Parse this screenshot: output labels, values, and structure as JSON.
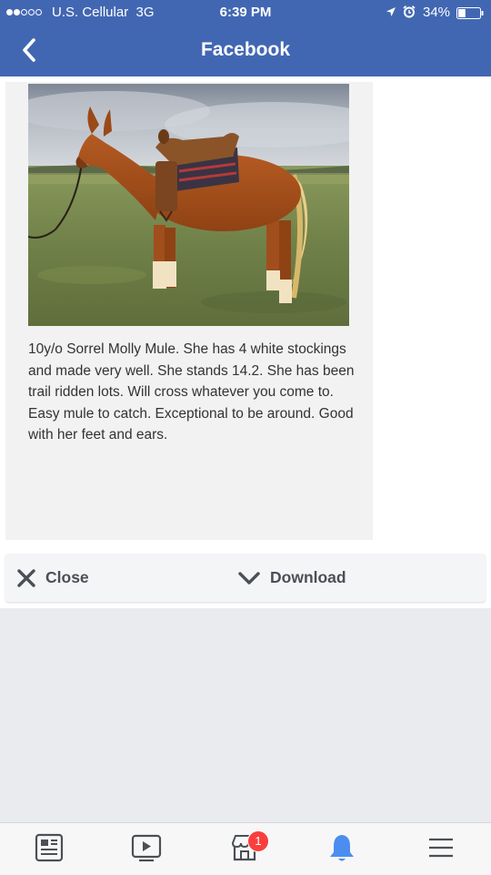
{
  "status_bar": {
    "signal_dots": 5,
    "signal_filled": 2,
    "carrier": "U.S. Cellular",
    "network": "3G",
    "time": "6:39 PM",
    "battery_percent": "34%",
    "battery_level": 0.34,
    "icons": [
      "location-arrow-icon",
      "alarm-clock-icon",
      "battery-icon"
    ]
  },
  "header": {
    "back_icon": "chevron-left-icon",
    "title": "Facebook"
  },
  "post": {
    "photo": "horse-photo",
    "text": "10y/o Sorrel Molly Mule. She has 4 white stockings  and made very well. She stands 14.2. She has been trail ridden lots. Will cross whatever you come to. Easy mule to catch. Exceptional to be around. Good with her feet and ears."
  },
  "actions": {
    "close_label": "Close",
    "close_icon": "x-icon",
    "download_label": "Download",
    "download_icon": "chevron-down-icon"
  },
  "tab_bar": {
    "tabs": [
      {
        "name": "news-feed",
        "icon": "news-feed-icon",
        "active": false
      },
      {
        "name": "watch",
        "icon": "video-play-icon",
        "active": false
      },
      {
        "name": "marketplace",
        "icon": "marketplace-shop-icon",
        "active": false,
        "badge": "1"
      },
      {
        "name": "notifications",
        "icon": "bell-icon",
        "active": true
      },
      {
        "name": "menu",
        "icon": "hamburger-menu-icon",
        "active": false
      }
    ]
  },
  "colors": {
    "brand_blue": "#4267b2",
    "active_tab": "#4b8ef0",
    "badge_red": "#fa3e3e",
    "icon_gray": "#4b4f56"
  }
}
